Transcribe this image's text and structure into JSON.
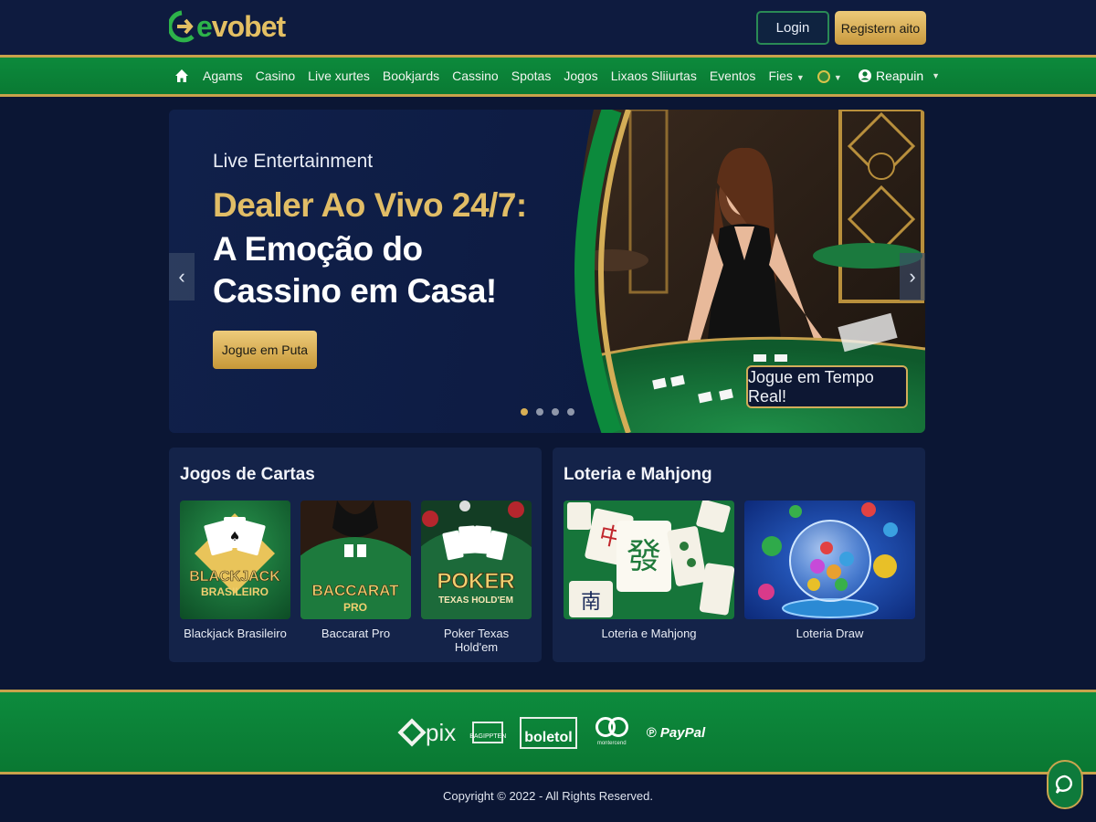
{
  "header": {
    "logo_text_a": "e",
    "logo_text_b": "vobet",
    "login_label": "Login",
    "register_label": "Registern aito"
  },
  "nav": {
    "items": [
      "Agams",
      "Casino",
      "Live xurtes",
      "Bookjards",
      "Cassino",
      "Spotas",
      "Jogos",
      "Lixaos Sliiurtas",
      "Eventos",
      "Fies"
    ],
    "user_label": "Reapuin"
  },
  "hero": {
    "eyebrow": "Live Entertainment",
    "title_line1": "Dealer Ao Vivo 24/7:",
    "title_line2": "A Emoção do Cassino em Casa!",
    "cta_label": "Jogue em Puta",
    "badge_label": "Jogue em Tempo Real!",
    "slide_count": 4,
    "active_slide": 1
  },
  "sections": {
    "cards": {
      "title": "Jogos de Cartas",
      "items": [
        {
          "label": "Blackjack Brasileiro",
          "art_line1": "BLACKJACK",
          "art_line2": "BRASILEIRO"
        },
        {
          "label": "Baccarat Pro",
          "art_line1": "BACCARAT",
          "art_line2": "PRO"
        },
        {
          "label": "Poker Texas Hold'em",
          "art_line1": "POKER",
          "art_line2": "TEXAS HOLD'EM"
        }
      ]
    },
    "lottery": {
      "title": "Loteria e Mahjong",
      "items": [
        {
          "label": "Loteria e Mahjong"
        },
        {
          "label": "Loteria Draw"
        }
      ]
    }
  },
  "payments": {
    "pix_label": "pix",
    "bb_label": "BAGIPPTEN",
    "boleto_label": "boletol",
    "mc_sub": "montercend",
    "paypal_label": "PayPal"
  },
  "footer": {
    "copyright": "Copyright © 2022 - All Rights Reserved."
  },
  "colors": {
    "brand_green": "#0c8a3c",
    "brand_gold": "#d4ad56",
    "background_navy": "#0b1634"
  }
}
